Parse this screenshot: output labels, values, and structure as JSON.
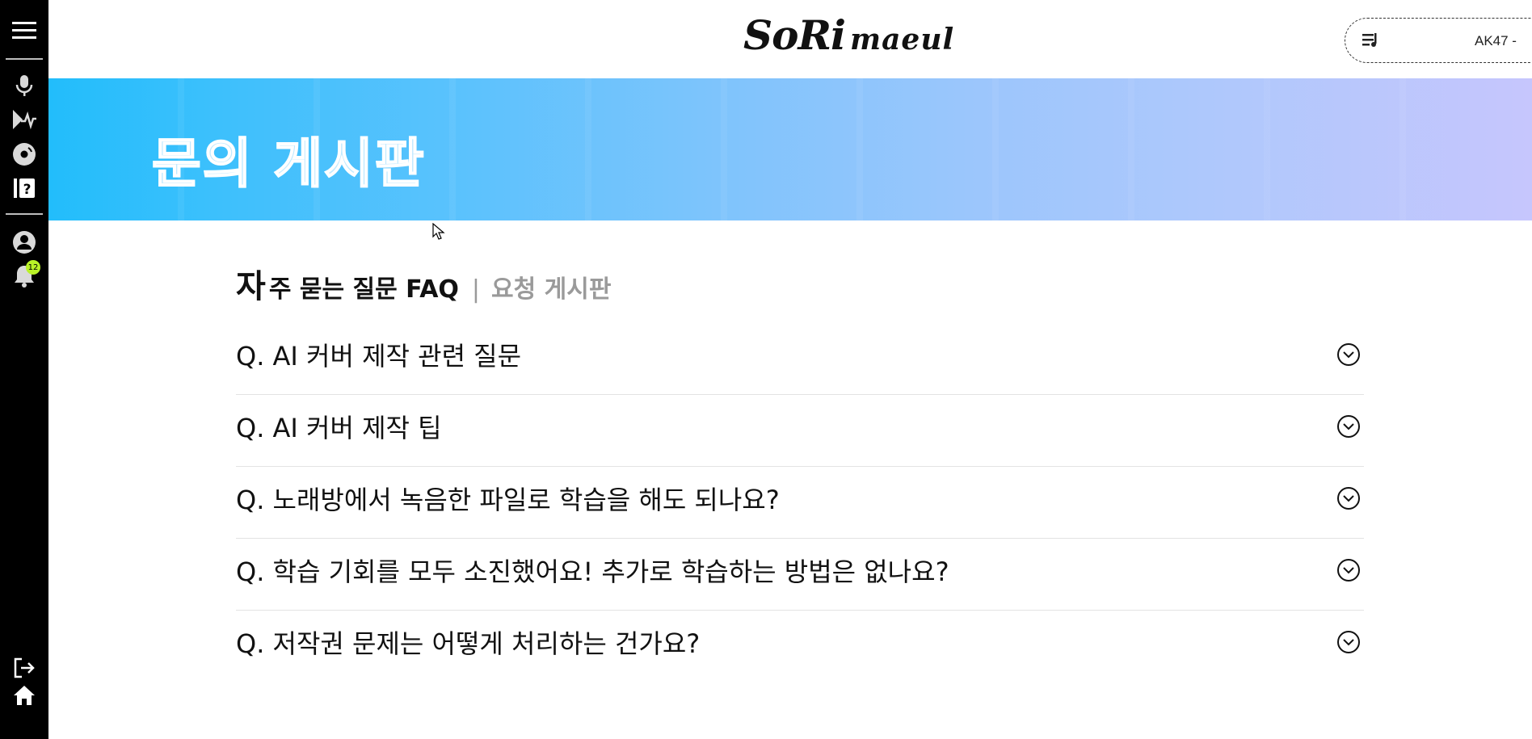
{
  "sidebar": {
    "top_icons": [
      "menu-icon",
      "microphone-icon",
      "voice-training-icon",
      "disc-icon",
      "help-book-icon"
    ],
    "bottom_icons": [
      "profile-icon",
      "bell-icon"
    ],
    "notification_count": "12",
    "footer_icons": [
      "logout-icon",
      "home-icon"
    ]
  },
  "header": {
    "logo_main": "SoRi",
    "logo_sub": "maeul",
    "player": {
      "track": "AK47 -",
      "icons": [
        "playlist-icon",
        "previous-icon",
        "play-icon",
        "next-icon"
      ]
    }
  },
  "banner": {
    "title": "문의 게시판",
    "colors": {
      "start": "#22bdfb",
      "end": "#c6c6fd"
    }
  },
  "tabs": {
    "active_first_char": "자",
    "active_rest": "주 묻는 질문 FAQ",
    "separator": "|",
    "inactive": "요청 게시판"
  },
  "faq": [
    {
      "question": "Q. AI 커버 제작 관련 질문"
    },
    {
      "question": "Q. AI 커버 제작 팁"
    },
    {
      "question": "Q. 노래방에서 녹음한 파일로 학습을 해도 되나요?"
    },
    {
      "question": "Q. 학습 기회를 모두 소진했어요! 추가로 학습하는 방법은 없나요?"
    },
    {
      "question": "Q. 저작권 문제는 어떻게 처리하는 건가요?"
    }
  ]
}
